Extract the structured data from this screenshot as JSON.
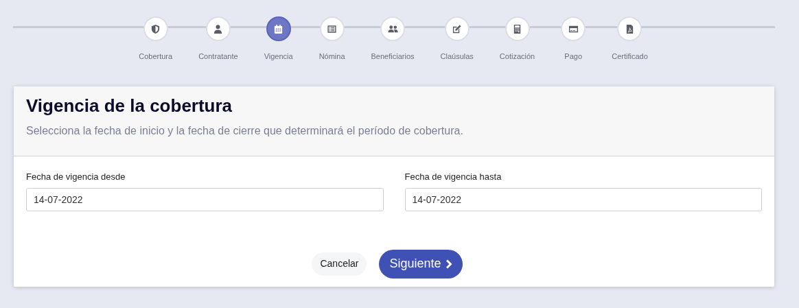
{
  "steps": [
    {
      "label": "Cobertura",
      "kind": "shield",
      "selected": false
    },
    {
      "label": "Contratante",
      "kind": "user",
      "selected": false
    },
    {
      "label": "Vigencia",
      "kind": "calendar",
      "selected": true
    },
    {
      "label": "Nómina",
      "kind": "list",
      "selected": false
    },
    {
      "label": "Beneficiarios",
      "kind": "users",
      "selected": false
    },
    {
      "label": "Claúsulas",
      "kind": "edit",
      "selected": false
    },
    {
      "label": "Cotización",
      "kind": "calculator",
      "selected": false
    },
    {
      "label": "Pago",
      "kind": "card",
      "selected": false
    },
    {
      "label": "Certificado",
      "kind": "pdf",
      "selected": false
    }
  ],
  "card": {
    "title": "Vigencia de la cobertura",
    "subtitle": "Selecciona la fecha de inicio y la fecha de cierre que determinará el período de cobertura.",
    "fields": [
      {
        "label": "Fecha de vigencia desde",
        "value": "14-07-2022"
      },
      {
        "label": "Fecha de vigencia hasta",
        "value": "14-07-2022"
      }
    ],
    "buttons": [
      {
        "label": "Cancelar",
        "kind": "secondary"
      },
      {
        "label": "Siguiente",
        "kind": "primary"
      }
    ]
  }
}
